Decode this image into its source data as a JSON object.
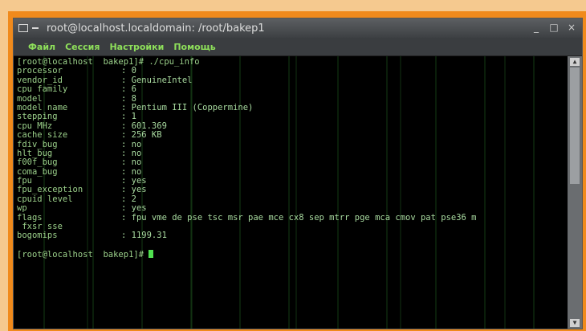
{
  "window": {
    "title": "root@localhost.localdomain: /root/bakep1",
    "buttons": [
      "_",
      "□",
      "×"
    ]
  },
  "menu": [
    "Файл",
    "Сессия",
    "Настройки",
    "Помощь"
  ],
  "terminal": {
    "command_line": "[root@localhost  bakep1]# ./cpu_info",
    "fields": [
      {
        "key": "processor",
        "value": ": 0"
      },
      {
        "key": "vendor_id",
        "value": ": GenuineIntel"
      },
      {
        "key": "cpu family",
        "value": ": 6"
      },
      {
        "key": "model",
        "value": ": 8"
      },
      {
        "key": "model name",
        "value": ": Pentium III (Coppermine)"
      },
      {
        "key": "stepping",
        "value": ": 1"
      },
      {
        "key": "cpu MHz",
        "value": ": 601.369"
      },
      {
        "key": "cache size",
        "value": ": 256 KB"
      },
      {
        "key": "fdiv_bug",
        "value": ": no"
      },
      {
        "key": "hlt_bug",
        "value": ": no"
      },
      {
        "key": "f00f_bug",
        "value": ": no"
      },
      {
        "key": "coma_bug",
        "value": ": no"
      },
      {
        "key": "fpu",
        "value": ": yes"
      },
      {
        "key": "fpu_exception",
        "value": ": yes"
      },
      {
        "key": "cpuid level",
        "value": ": 2"
      },
      {
        "key": "wp",
        "value": ": yes"
      },
      {
        "key": "flags",
        "value": ": fpu vme de pse tsc msr pae mce cx8 sep mtrr pge mca cmov pat pse36 m"
      },
      {
        "key": " fxsr sse",
        "value": ""
      },
      {
        "key": "bogomips",
        "value": ": 1199.31"
      }
    ],
    "final_prompt": "[root@localhost  bakep1]# "
  }
}
